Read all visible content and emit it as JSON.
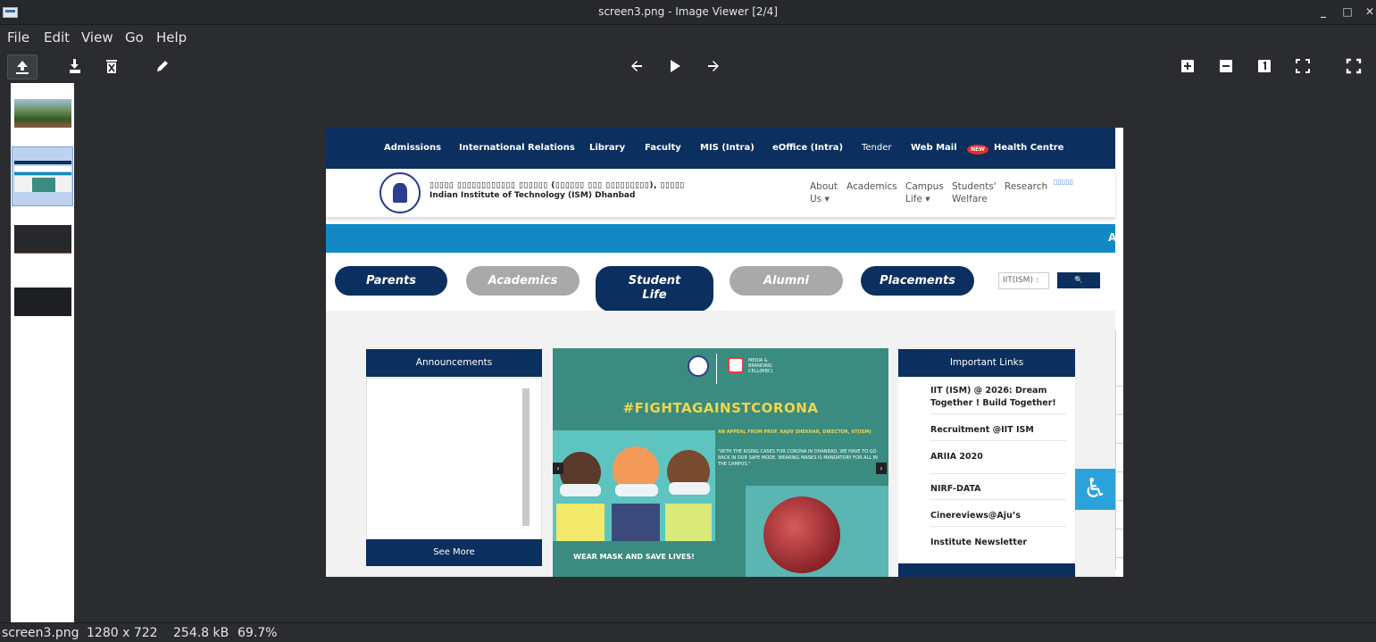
{
  "window": {
    "title": "screen3.png - Image Viewer [2/4]",
    "controls": [
      "_",
      "□",
      "✕"
    ]
  },
  "menu": [
    "File",
    "Edit",
    "View",
    "Go",
    "Help"
  ],
  "status": {
    "filename": "screen3.png",
    "dimensions": "1280 x 722",
    "filesize": "254.8 kB",
    "zoom": "69.7%"
  },
  "webpage": {
    "topnav": [
      "Admissions",
      "International Relations",
      "Library",
      "Faculty",
      "MIS (Intra)",
      "eOffice (Intra)",
      "Tender",
      "Web Mail",
      "Health Centre"
    ],
    "new_badge": "NEW",
    "hindi_name": "▯▯▯▯▯ ▯▯▯▯▯▯▯▯▯▯▯▯ ▯▯▯▯▯▯ (▯▯▯▯▯▯ ▯▯▯ ▯▯▯▯▯▯▯▯▯), ▯▯▯▯▯",
    "english_name": "Indian Institute of Technology (ISM) Dhanbad",
    "header_links": [
      {
        "line1": "About",
        "line2": "Us ▾"
      },
      {
        "line1": "Academics",
        "line2": ""
      },
      {
        "line1": "Campus",
        "line2": "Life ▾"
      },
      {
        "line1": "Students'",
        "line2": "Welfare"
      },
      {
        "line1": "Research",
        "line2": ""
      }
    ],
    "lang_glyphs": "▯▯▯▯▯",
    "ticker": "A",
    "pills": [
      "Parents",
      "Academics",
      "Student Life",
      "Alumni",
      "Placements"
    ],
    "search_placeholder": "IIT(ISM) :",
    "search_icon": "🔍",
    "announcements_title": "Announcements",
    "see_more": "See More",
    "important_links_title": "Important Links",
    "important_links": [
      "IIT (ISM) @ 2026: Dream Together ! Build Together!",
      "Recruitment @IIT ISM",
      "ARIIA 2020",
      "NIRF-DATA",
      "Cinereviews@Aju’s",
      "Institute Newsletter"
    ],
    "poster": {
      "mbc_label": "MEDIA & BRANDING CELL(MBC)",
      "hashtag": "#FIGHTAGAINSTCORONA",
      "appeal": "AN APPEAL FROM PROF. RAJIV SHEKHAR, DIRECTOR, IIT(ISM)",
      "quote": "\"WITH THE RISING CASES FOR CORONA IN DHANBAD, WE HAVE TO GO BACK IN OUR SAFE MODE. WEARING MASKS IS MANDATORY FOR ALL IN THE CAMPUS.\"",
      "slogan": "WEAR MASK AND SAVE LIVES!"
    }
  },
  "colors": {
    "navy": "#0b2f5e",
    "ticker_blue": "#1289c4",
    "poster_teal": "#3a8c80",
    "hashtag_yellow": "#f3d54a"
  }
}
